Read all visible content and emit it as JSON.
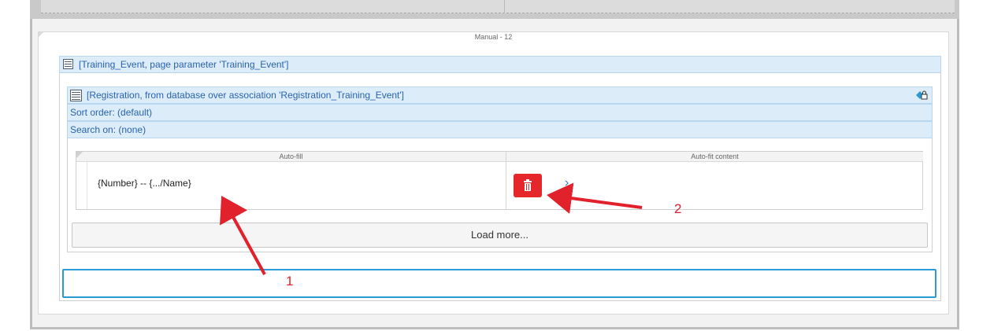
{
  "layout_caption": "Manual - 12",
  "dataview": {
    "header": "[Training_Event, page parameter 'Training_Event']"
  },
  "listview": {
    "header": "[Registration, from database over association 'Registration_Training_Event']",
    "sort_order": "Sort order: (default)",
    "search_on": "Search on: (none)",
    "columns": [
      {
        "label": "Auto-fill"
      },
      {
        "label": "Auto-fit content"
      }
    ],
    "template_text": "{Number} -- {.../Name}",
    "delete_icon": "trash-icon",
    "chevron_icon": "chevron-right-icon",
    "load_more_label": "Load more..."
  },
  "annotations": {
    "arrow_1_label": "1",
    "arrow_2_label": "2",
    "color": "#e1212b"
  },
  "colors": {
    "accent_blue": "#2a9bd6",
    "header_blue_bg": "#dcecf8",
    "delete_red": "#e5262b"
  }
}
